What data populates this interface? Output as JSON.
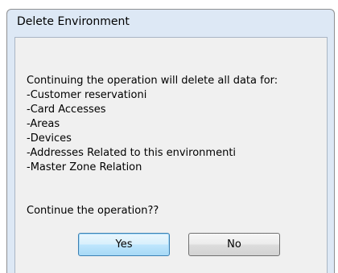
{
  "dialog": {
    "title": "Delete Environment",
    "message_lines": [
      "Continuing the operation will delete all data for:",
      "-Customer reservationi",
      "-Card Accesses",
      "-Areas",
      "-Devices",
      "-Addresses Related to this environmenti",
      "-Master Zone Relation"
    ],
    "question": "Continue the operation??",
    "buttons": {
      "yes_label": "Yes",
      "no_label": "No"
    }
  }
}
